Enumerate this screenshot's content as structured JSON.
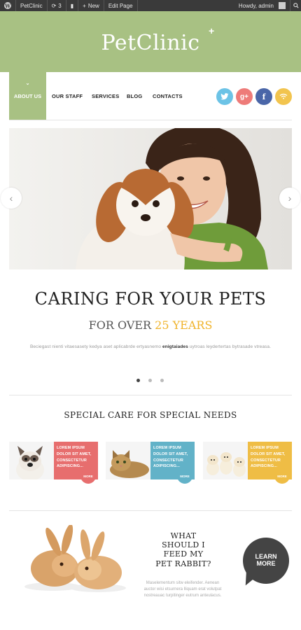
{
  "adminbar": {
    "site_name": "PetClinic",
    "updates_count": "3",
    "new_label": "New",
    "edit_label": "Edit Page",
    "howdy": "Howdy, admin"
  },
  "header": {
    "logo_text": "PetClinic",
    "logo_mark": "+"
  },
  "nav": {
    "items": [
      {
        "label": "ABOUT US",
        "active": true
      },
      {
        "label": "OUR STAFF"
      },
      {
        "label": "SERVICES"
      },
      {
        "label": "BLOG"
      },
      {
        "label": "CONTACTS"
      }
    ]
  },
  "social": [
    {
      "name": "twitter",
      "glyph": "🐦",
      "color": "#6cc3e6"
    },
    {
      "name": "googleplus",
      "glyph": "g+",
      "color": "#ee7b79"
    },
    {
      "name": "facebook",
      "glyph": "f",
      "color": "#4a66a8"
    },
    {
      "name": "rss",
      "glyph": "◠",
      "color": "#f2c44e"
    }
  ],
  "hero": {
    "title": "CARING FOR YOUR PETS",
    "subtitle_prefix": "FOR OVER",
    "subtitle_highlight": "25 YEARS",
    "text_before": "Beciegast nienti vitaesasety kedya aset aplicabrde ertyasnemo",
    "text_bold": "enigtaiades",
    "text_after": "uytroas leydertertas bytrasade vtreasa.",
    "slides_count": 3,
    "active_slide": 1
  },
  "special": {
    "title": "SPECIAL CARE FOR SPECIAL NEEDS",
    "cards": [
      {
        "text": "LOREM IPSUM DOLOR SIT AMET, CONSECTETUR ADIPISCING...",
        "more": "MORE",
        "color": "#e76e6e"
      },
      {
        "text": "LOREM IPSUM DOLOR SIT AMET, CONSECTETUR ADIPISCING...",
        "more": "MORE",
        "color": "#62b2c8"
      },
      {
        "text": "LOREM IPSUM DOLOR SIT AMET, CONSECTETUR ADIPISCING...",
        "more": "MORE",
        "color": "#efbd45"
      }
    ]
  },
  "promo": {
    "question": "WHAT SHOULD I FEED MY PET RABBIT?",
    "text": "Maselementum sitw eleifender. Aenean auctor wisi etsurnera lliquam erat volutpat nostreauac turpitinger eutrum anteulacus.",
    "button": "LEARN MORE"
  },
  "colors": {
    "brand_green": "#a8c183",
    "accent_gold": "#f0b32a"
  }
}
